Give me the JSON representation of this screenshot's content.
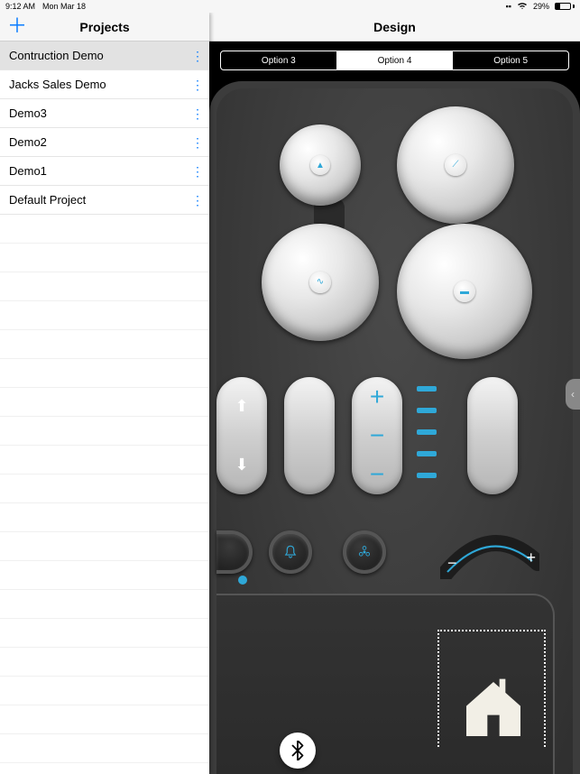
{
  "status": {
    "time": "9:12 AM",
    "date": "Mon Mar 18",
    "signal": "▪▪",
    "wifi": "᯾",
    "battery_pct": "29%"
  },
  "sidebar": {
    "title": "Projects",
    "add_glyph": "＋",
    "items": [
      {
        "label": "Contruction Demo",
        "selected": true
      },
      {
        "label": "Jacks Sales Demo",
        "selected": false
      },
      {
        "label": "Demo3",
        "selected": false
      },
      {
        "label": "Demo2",
        "selected": false
      },
      {
        "label": "Demo1",
        "selected": false
      },
      {
        "label": "Default Project",
        "selected": false
      }
    ],
    "menu_glyph": "⋮"
  },
  "main": {
    "title": "Design",
    "tabs": [
      {
        "label": "Option 3",
        "active": false
      },
      {
        "label": "Option 4",
        "active": true
      },
      {
        "label": "Option 5",
        "active": false
      }
    ]
  },
  "controls": {
    "knob1_glyph": "▲",
    "knob2_glyph": "⟋",
    "knob3_glyph": "∿",
    "knob4_glyph": "▬",
    "up_arrow": "⬆",
    "down_arrow": "⬇",
    "plus_big": "+",
    "minus_big": "−",
    "bell": "△",
    "fan": "❋",
    "arc_minus": "−",
    "arc_plus": "+",
    "bluetooth": "ᛒ",
    "drawer": "‹"
  }
}
